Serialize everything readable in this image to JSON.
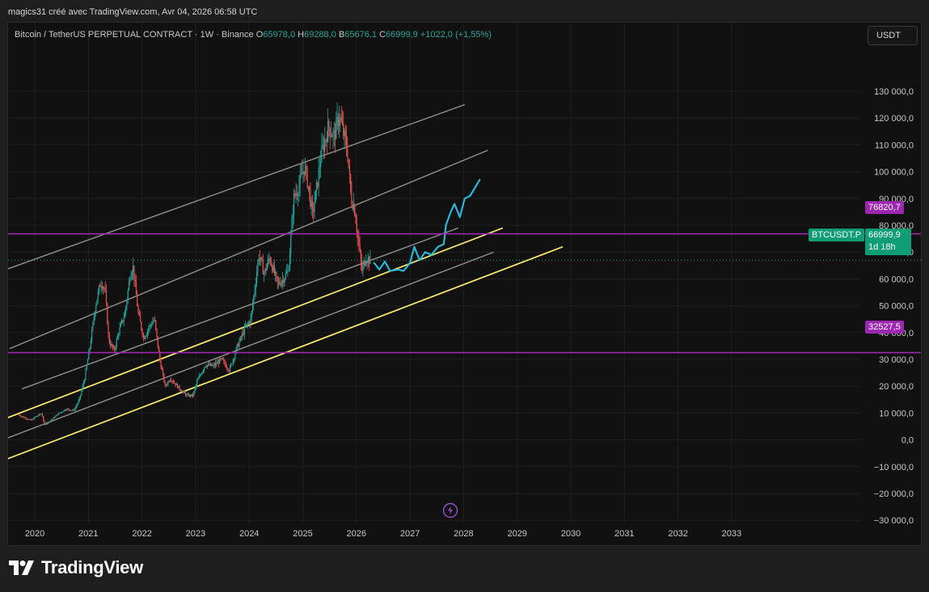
{
  "header": {
    "meta": "magics31 créé avec TradingView.com, Avr 04, 2026 06:58 UTC"
  },
  "legend": {
    "symbol": "Bitcoin / TetherUS PERPETUAL CONTRACT · 1W · Binance",
    "open_label": "O",
    "open": "65978,0",
    "high_label": "H",
    "high": "69288,0",
    "low_label": "B",
    "low": "65676,1",
    "close_label": "C",
    "close": "66999,9",
    "change": "+1022,0 (+1,55%)"
  },
  "currency_button": {
    "label": "USDT"
  },
  "price_tags": {
    "upper": "76820,7",
    "lower": "32527,5",
    "symbol": "BTCUSDT.P",
    "current": "66999,9",
    "countdown": "1d 18h"
  },
  "colors": {
    "background": "#111111",
    "grid": "#1f1f1f",
    "axis_text": "#c8c8c8",
    "channel_gray": "#8a8a8a",
    "channel_yellow": "#f2e56b",
    "horizontal_purple": "#9c27b0",
    "projection_cyan": "#29b6d8",
    "up_candle": "#26a69a",
    "down_candle": "#ef5350"
  },
  "icons": {
    "replay": "lightning-bolt-icon",
    "brand": "tradingview-logo-icon"
  },
  "brand": {
    "name": "TradingView"
  },
  "chart_data": {
    "type": "candlestick",
    "interval": "1W",
    "x_axis_labels": [
      "2020",
      "2021",
      "2022",
      "2023",
      "2024",
      "2025",
      "2026",
      "2027",
      "2028",
      "2029",
      "2030",
      "2031",
      "2032",
      "2033"
    ],
    "y_axis_labels": [
      {
        "value": 130000,
        "label": "130 000,0"
      },
      {
        "value": 120000,
        "label": "120 000,0"
      },
      {
        "value": 110000,
        "label": "110 000,0"
      },
      {
        "value": 100000,
        "label": "100 000,0"
      },
      {
        "value": 90000,
        "label": "90 000,0"
      },
      {
        "value": 80000,
        "label": "80 000,0"
      },
      {
        "value": 70000,
        "label": "70 000,0"
      },
      {
        "value": 60000,
        "label": "60 000,0"
      },
      {
        "value": 50000,
        "label": "50 000,0"
      },
      {
        "value": 40000,
        "label": "40 000,0"
      },
      {
        "value": 30000,
        "label": "30 000,0"
      },
      {
        "value": 20000,
        "label": "20 000,0"
      },
      {
        "value": 10000,
        "label": "10 000,0"
      },
      {
        "value": 0,
        "label": "0,0"
      },
      {
        "value": -10000,
        "label": "−10 000,0"
      },
      {
        "value": -20000,
        "label": "−20 000,0"
      },
      {
        "value": -30000,
        "label": "−30 000,0"
      }
    ],
    "ylim": [
      -40000,
      137000
    ],
    "xlim": [
      2019.0,
      2033.8
    ],
    "price_path": [
      [
        2019.7,
        9500
      ],
      [
        2019.8,
        8500
      ],
      [
        2019.95,
        7300
      ],
      [
        2020.05,
        8800
      ],
      [
        2020.15,
        9800
      ],
      [
        2020.2,
        5500
      ],
      [
        2020.3,
        7000
      ],
      [
        2020.45,
        9600
      ],
      [
        2020.6,
        11500
      ],
      [
        2020.75,
        11000
      ],
      [
        2020.85,
        15000
      ],
      [
        2020.95,
        23000
      ],
      [
        2021.05,
        35000
      ],
      [
        2021.15,
        50000
      ],
      [
        2021.25,
        59000
      ],
      [
        2021.33,
        56000
      ],
      [
        2021.4,
        37000
      ],
      [
        2021.5,
        33000
      ],
      [
        2021.58,
        40000
      ],
      [
        2021.7,
        47000
      ],
      [
        2021.8,
        62000
      ],
      [
        2021.85,
        65000
      ],
      [
        2021.95,
        47000
      ],
      [
        2022.05,
        38000
      ],
      [
        2022.15,
        42000
      ],
      [
        2022.25,
        45000
      ],
      [
        2022.35,
        30000
      ],
      [
        2022.45,
        20000
      ],
      [
        2022.55,
        23000
      ],
      [
        2022.7,
        19500
      ],
      [
        2022.85,
        16500
      ],
      [
        2022.97,
        16600
      ],
      [
        2023.05,
        22000
      ],
      [
        2023.2,
        28000
      ],
      [
        2023.35,
        27500
      ],
      [
        2023.5,
        30000
      ],
      [
        2023.65,
        26000
      ],
      [
        2023.8,
        35000
      ],
      [
        2023.95,
        42000
      ],
      [
        2024.05,
        45000
      ],
      [
        2024.2,
        69000
      ],
      [
        2024.3,
        62000
      ],
      [
        2024.4,
        68000
      ],
      [
        2024.55,
        58000
      ],
      [
        2024.65,
        60000
      ],
      [
        2024.75,
        63000
      ],
      [
        2024.85,
        90000
      ],
      [
        2024.95,
        95000
      ],
      [
        2025.05,
        102000
      ],
      [
        2025.12,
        95000
      ],
      [
        2025.2,
        84000
      ],
      [
        2025.28,
        94000
      ],
      [
        2025.35,
        105000
      ],
      [
        2025.5,
        117000
      ],
      [
        2025.6,
        113000
      ],
      [
        2025.7,
        121000
      ],
      [
        2025.78,
        114000
      ],
      [
        2025.85,
        108000
      ],
      [
        2025.92,
        90000
      ],
      [
        2025.98,
        87000
      ],
      [
        2026.05,
        75000
      ],
      [
        2026.12,
        63000
      ],
      [
        2026.2,
        68000
      ],
      [
        2026.26,
        67000
      ]
    ],
    "channels": [
      {
        "color": "gray",
        "points": [
          [
            2018.0,
            53000
          ],
          [
            2028.02,
            125000
          ]
        ]
      },
      {
        "color": "gray",
        "points": [
          [
            2019.53,
            34000
          ],
          [
            2028.45,
            108000
          ]
        ]
      },
      {
        "color": "gray",
        "points": [
          [
            2019.76,
            19000
          ],
          [
            2027.9,
            79000
          ]
        ]
      },
      {
        "color": "yellow",
        "points": [
          [
            2019.33,
            7000
          ],
          [
            2028.73,
            79000
          ]
        ]
      },
      {
        "color": "gray",
        "points": [
          [
            2018.88,
            -4000
          ],
          [
            2028.56,
            70000
          ]
        ]
      },
      {
        "color": "yellow",
        "points": [
          [
            2018.78,
            -12500
          ],
          [
            2029.85,
            72000
          ]
        ]
      }
    ],
    "horizontal_levels": [
      76820.7,
      32527.5
    ],
    "current_price": 66999.9,
    "projection": [
      [
        2026.33,
        66000
      ],
      [
        2026.43,
        63500
      ],
      [
        2026.53,
        66500
      ],
      [
        2026.63,
        63000
      ],
      [
        2026.78,
        63500
      ],
      [
        2026.88,
        63000
      ],
      [
        2027.0,
        66000
      ],
      [
        2027.08,
        72000
      ],
      [
        2027.18,
        67000
      ],
      [
        2027.28,
        70000
      ],
      [
        2027.4,
        69000
      ],
      [
        2027.52,
        72000
      ],
      [
        2027.63,
        73000
      ],
      [
        2027.67,
        80000
      ],
      [
        2027.76,
        85000
      ],
      [
        2027.83,
        88000
      ],
      [
        2027.93,
        83000
      ],
      [
        2028.02,
        90000
      ],
      [
        2028.12,
        91000
      ],
      [
        2028.3,
        97000
      ]
    ],
    "grid": true
  }
}
